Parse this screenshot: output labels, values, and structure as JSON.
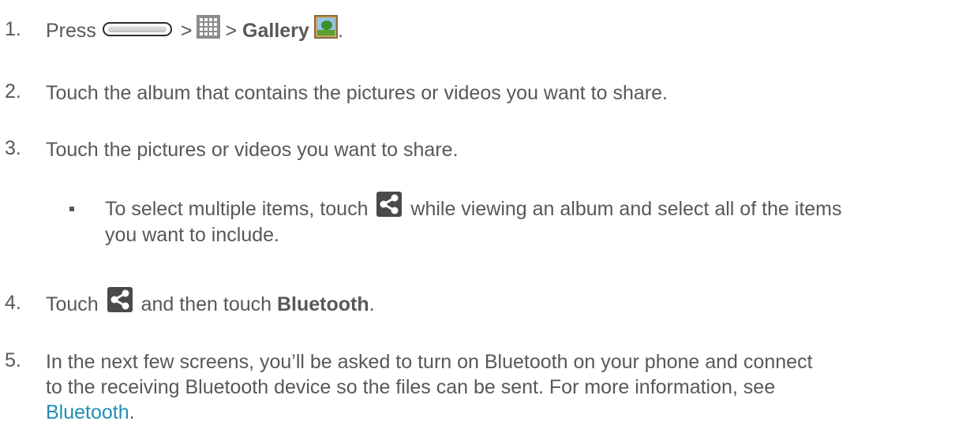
{
  "steps": [
    {
      "num": "1.",
      "press": "Press",
      "sep1": ">",
      "sep2": ">",
      "gallery": "Gallery",
      "end": "."
    },
    {
      "num": "2.",
      "text": "Touch the album that contains the pictures or videos you want to share."
    },
    {
      "num": "3.",
      "text": "Touch the pictures or videos you want to share."
    },
    {
      "num": "4.",
      "touch": "Touch",
      "mid": "and then touch",
      "bluetooth": "Bluetooth",
      "end": "."
    },
    {
      "num": "5.",
      "line1": "In the next few screens, you’ll be asked to turn on Bluetooth on your phone and connect",
      "line2": "to the receiving Bluetooth device so the files can be sent. For more information, see",
      "link": "Bluetooth",
      "end": "."
    }
  ],
  "bullet": {
    "before": "To select multiple items, touch",
    "after": "while viewing an album and select all of the items",
    "line2": "you want to include."
  },
  "icons": {
    "home_key": "home-key-icon",
    "apps": "apps-grid-icon",
    "gallery": "gallery-app-icon",
    "share": "share-icon"
  },
  "colors": {
    "text": "#58585a",
    "link": "#1f8fb5"
  }
}
